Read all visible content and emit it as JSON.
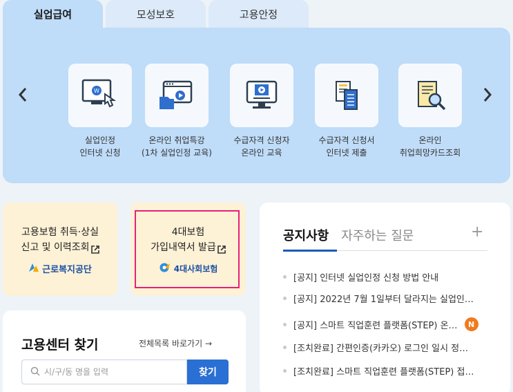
{
  "tabs": [
    {
      "label": "실업급여"
    },
    {
      "label": "모성보호"
    },
    {
      "label": "고용안정"
    }
  ],
  "services": [
    {
      "label": "실업인정\n인터넷 신청",
      "icon": "computer-click-icon"
    },
    {
      "label": "온라인 취업특강\n(1차 실업인정 교육)",
      "icon": "online-lecture-icon"
    },
    {
      "label": "수급자격 신청자\n온라인 교육",
      "icon": "monitor-play-icon"
    },
    {
      "label": "수급자격 신청서\n인터넷 제출",
      "icon": "document-submit-icon"
    },
    {
      "label": "온라인\n취업희망카드조회",
      "icon": "document-search-icon"
    }
  ],
  "cards": {
    "employment_insurance": {
      "title": "고용보험 취득·상실\n신고 및 이력조회",
      "org": "근로복지공단"
    },
    "social_insurance": {
      "title": "4대보험\n가입내역서 발급",
      "org": "4대사회보험"
    }
  },
  "notice": {
    "tabs": [
      "공지사항",
      "자주하는 질문"
    ],
    "more": "+",
    "items": [
      {
        "text": "[공지] 인터넷 실업인정 신청 방법 안내"
      },
      {
        "text": "[공지] 2022년 7월 1일부터 달라지는 실업인…"
      },
      {
        "text": "[공지] 스마트 직업훈련 플랫폼(STEP) 온…",
        "badge": "N"
      },
      {
        "text": "[조치완료] 간편인증(카카오) 로그인 일시 정…"
      },
      {
        "text": "[조치완료] 스마트 직업훈련 플랫폼(STEP) 접…"
      }
    ]
  },
  "finder": {
    "title": "고용센터 찾기",
    "link": "전체목록 바로가기 →",
    "placeholder": "시/구/동 명을 입력",
    "button": "찾기"
  },
  "colors": {
    "panel": "#bfdcf8",
    "card": "#fdf1d6",
    "highlight": "#e6207a",
    "primary": "#2a6fd4"
  }
}
